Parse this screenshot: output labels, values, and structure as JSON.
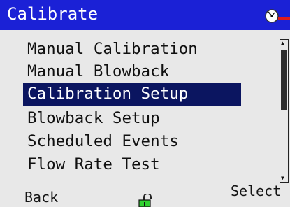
{
  "header": {
    "title": "Calibrate",
    "status_icon": "gauge-icon"
  },
  "menu": {
    "items": [
      {
        "label": "Manual Calibration",
        "selected": false
      },
      {
        "label": "Manual Blowback",
        "selected": false
      },
      {
        "label": "Calibration Setup",
        "selected": true
      },
      {
        "label": "Blowback Setup",
        "selected": false
      },
      {
        "label": "Scheduled Events",
        "selected": false
      },
      {
        "label": "Flow Rate Test",
        "selected": false
      }
    ]
  },
  "softkeys": {
    "left_label": "Back",
    "right_label": "Select",
    "center_icon": "unlocked-padlock-icon"
  },
  "colors": {
    "title_bar": "#1b21d6",
    "selection": "#0b1560",
    "background": "#e8e8e8"
  }
}
